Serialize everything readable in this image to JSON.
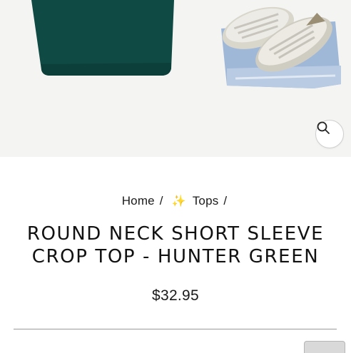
{
  "product_image": {
    "alt": "",
    "zoom_icon": "magnifier-icon",
    "colors": {
      "top": "#0f4a44",
      "denim": "#9fb8d8",
      "sneaker": "#e6e4dd"
    }
  },
  "breadcrumb": {
    "home": "Home",
    "separator": "/",
    "sparkle_icon": "✨",
    "tops": "Tops"
  },
  "product": {
    "title_line1": "ROUND NECK SHORT SLEEVE",
    "title_line2": "CROP TOP - HUNTER GREEN",
    "price": "$32.95"
  }
}
